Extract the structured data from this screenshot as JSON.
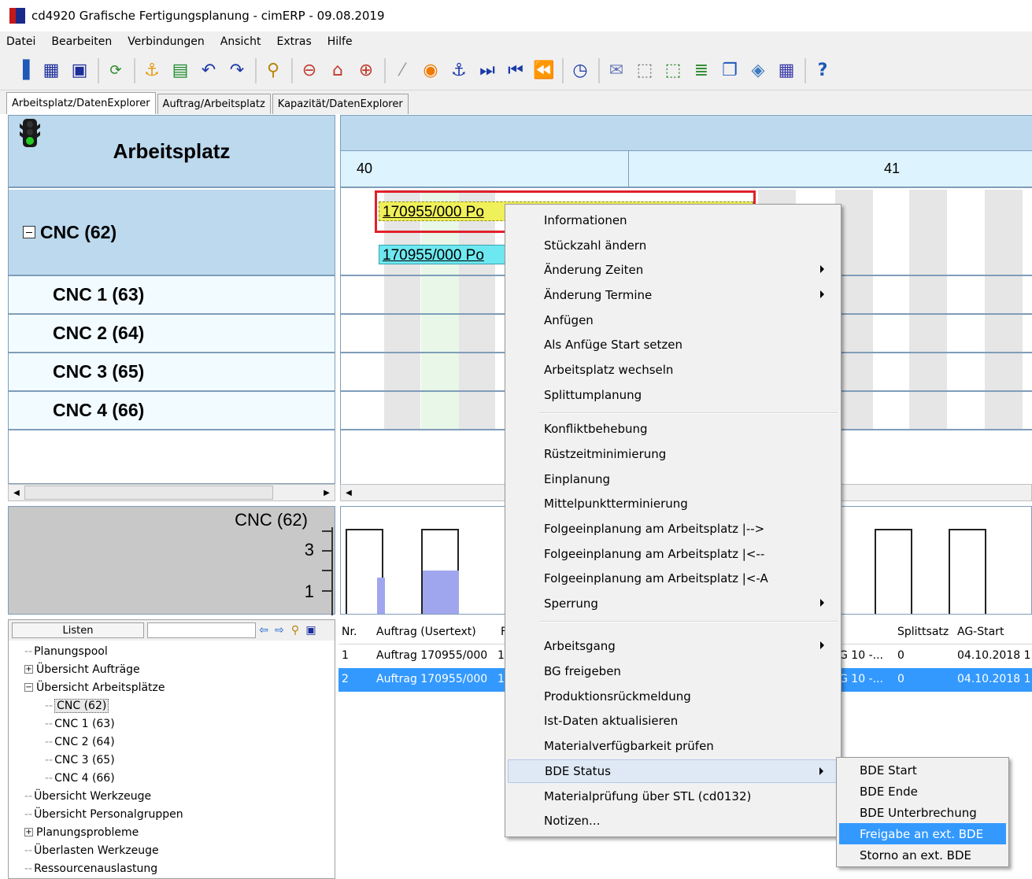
{
  "window": {
    "title": "cd4920 Grafische Fertigungsplanung - cimERP - 09.08.2019"
  },
  "menubar": [
    "Datei",
    "Bearbeiten",
    "Verbindungen",
    "Ansicht",
    "Extras",
    "Hilfe"
  ],
  "tabs": [
    "Arbeitsplatz/DatenExplorer",
    "Auftrag/Arbeitsplatz",
    "Kapazität/DatenExplorer"
  ],
  "resources": {
    "header": "Arbeitsplatz",
    "group": "CNC (62)",
    "rows": [
      "CNC 1 (63)",
      "CNC 2 (64)",
      "CNC 3 (65)",
      "CNC 4 (66)"
    ]
  },
  "gantt": {
    "weeks": [
      "40",
      "41"
    ],
    "bar1_label": "170955/000 Po",
    "bar2_label": "170955/000 Po"
  },
  "load_chart": {
    "resource": "CNC (62)",
    "y_ticks": [
      "3",
      "1"
    ],
    "bars": [
      {
        "capacity": 3,
        "load": 1
      },
      {
        "capacity": 3,
        "load": 1.2
      },
      {
        "capacity": 3,
        "load": 0
      },
      {
        "capacity": 3,
        "load": 0
      }
    ]
  },
  "lists": {
    "label": "Listen",
    "tree": [
      {
        "text": "Planungspool"
      },
      {
        "text": "Übersicht Aufträge",
        "exp": "+"
      },
      {
        "text": "Übersicht Arbeitsplätze",
        "exp": "−"
      },
      {
        "text": "CNC (62)"
      },
      {
        "text": "CNC 1 (63)"
      },
      {
        "text": "CNC 2 (64)"
      },
      {
        "text": "CNC 3 (65)"
      },
      {
        "text": "CNC 4 (66)"
      },
      {
        "text": "Übersicht Werkzeuge"
      },
      {
        "text": "Übersicht Personalgruppen"
      },
      {
        "text": "Planungsprobleme",
        "exp": "+"
      },
      {
        "text": "Überlasten Werkzeuge"
      },
      {
        "text": "Ressourcenauslastung"
      }
    ]
  },
  "orders": {
    "headers": [
      "Nr.",
      "Auftrag (Usertext)",
      "F",
      "Splittsatz",
      "AG-Start"
    ],
    "rows": [
      {
        "nr": "1",
        "auftrag": "Auftrag 170955/000",
        "col3": "1",
        "ag": "G 10 -...",
        "split": "0",
        "start": "04.10.2018 1"
      },
      {
        "nr": "2",
        "auftrag": "Auftrag 170955/000",
        "col3": "1",
        "ag": "G 10 -...",
        "split": "0",
        "start": "04.10.2018 1"
      }
    ]
  },
  "context_menu": [
    "Informationen",
    "Stückzahl ändern",
    "Änderung Zeiten",
    "Änderung Termine",
    "Anfügen",
    "Als Anfüge Start setzen",
    "Arbeitsplatz wechseln",
    "Splittumplanung",
    "Konfliktbehebung",
    "Rüstzeitminimierung",
    "Einplanung",
    "Mittelpunktterminierung",
    "Folgeeinplanung am Arbeitsplatz  |-->",
    "Folgeeinplanung am Arbeitsplatz  |<--",
    "Folgeeinplanung am Arbeitsplatz  |<-A",
    "Sperrung",
    "Arbeitsgang",
    "BG freigeben",
    "Produktionsrückmeldung",
    "Ist-Daten aktualisieren",
    "Materialverfügbarkeit prüfen",
    "BDE Status",
    "Materialprüfung über STL (cd0132)",
    "Notizen..."
  ],
  "sub_menu": [
    "BDE Start",
    "BDE Ende",
    "BDE Unterbrechung",
    "Freigabe an ext. BDE",
    "Storno an ext. BDE"
  ],
  "colors": {
    "resource_header": "#bcd9ee",
    "bar_planned": "#f0f05a",
    "bar_alt": "#6ee8f0",
    "selection_frame": "#e0202a",
    "load_fill": "#a0a6ee",
    "highlight": "#3399ff"
  },
  "icons": {
    "toolbar": [
      "exit-icon",
      "save-all-icon",
      "save-icon",
      "refresh-icon",
      "anchor-icon",
      "list-icon",
      "undo-icon",
      "redo-icon",
      "search-icon",
      "zoom-out-icon",
      "reset-icon",
      "zoom-in-icon",
      "magic-wand-icon",
      "stop-icon",
      "anchor-blue-icon",
      "go-end-icon",
      "go-start-icon",
      "go-first-icon",
      "timer-icon",
      "mail-icon",
      "move-icon",
      "select-area-icon",
      "move-list-icon",
      "window-icon",
      "tag-icon",
      "calendar-icon",
      "help-icon"
    ]
  }
}
